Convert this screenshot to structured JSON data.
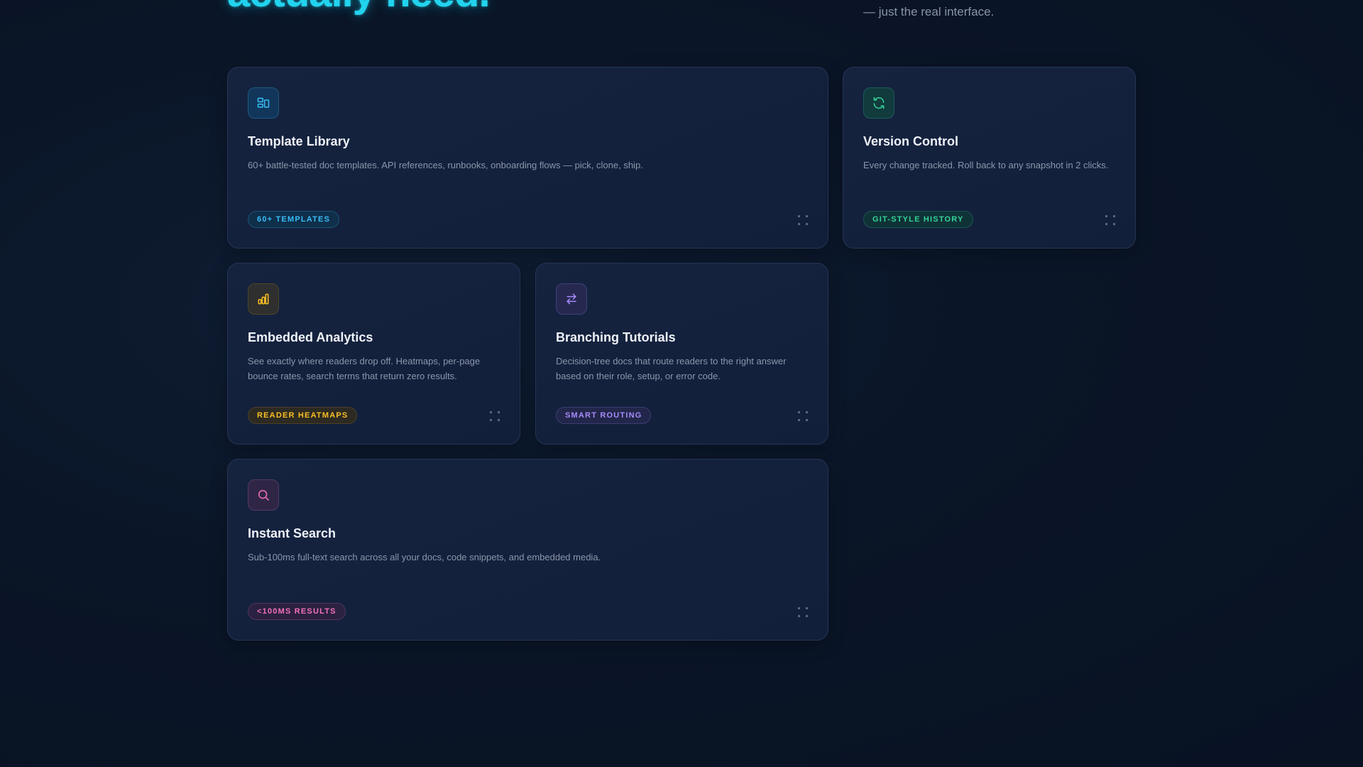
{
  "hero": {
    "title": "actually need.",
    "subtitle": "— just the real interface."
  },
  "cards": [
    {
      "title": "Template Library",
      "description": "60+ battle-tested doc templates. API references, runbooks, onboarding flows — pick, clone, ship.",
      "badge": "60+ TEMPLATES",
      "icon": "layout-icon",
      "accent": "#38bdf8"
    },
    {
      "title": "Version Control",
      "description": "Every change tracked. Roll back to any snapshot in 2 clicks.",
      "badge": "GIT-STYLE HISTORY",
      "icon": "refresh-icon",
      "accent": "#34d399"
    },
    {
      "title": "Embedded Analytics",
      "description": "See exactly where readers drop off. Heatmaps, per-page bounce rates, search terms that return zero results.",
      "badge": "READER HEATMAPS",
      "icon": "bar-chart-icon",
      "accent": "#fbbf24"
    },
    {
      "title": "Branching Tutorials",
      "description": "Decision-tree docs that route readers to the right answer based on their role, setup, or error code.",
      "badge": "SMART ROUTING",
      "icon": "arrows-swap-icon",
      "accent": "#a78bfa"
    },
    {
      "title": "Instant Search",
      "description": "Sub-100ms full-text search across all your docs, code snippets, and embedded media.",
      "badge": "<100MS RESULTS",
      "icon": "search-icon",
      "accent": "#f472b6"
    }
  ]
}
